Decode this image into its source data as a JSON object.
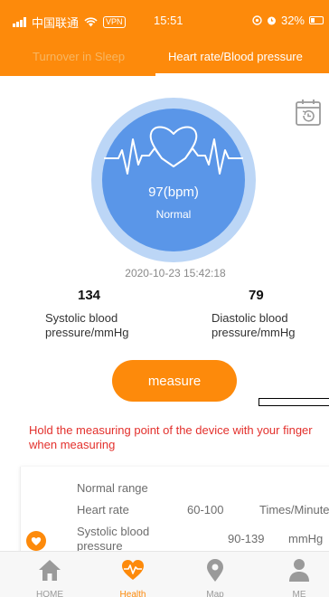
{
  "status_bar": {
    "carrier": "中国联通",
    "vpn": "VPN",
    "time": "15:51",
    "battery": "32%",
    "battery_level": 0.32
  },
  "tabs": [
    {
      "label": "Turnover in Sleep",
      "active": false
    },
    {
      "label": "Heart rate/Blood pressure",
      "active": true
    }
  ],
  "reading": {
    "bpm": "97(bpm)",
    "status": "Normal",
    "datetime": "2020-10-23 15:42:18",
    "systolic_value": "134",
    "systolic_label": "Systolic blood pressure/mmHg",
    "diastolic_value": "79",
    "diastolic_label": "Diastolic blood pressure/mmHg"
  },
  "measure_button": "measure",
  "hint": "Hold the measuring point of the device with your finger when measuring",
  "normal_range": {
    "title": "Normal range",
    "heart_rate_label": "Heart rate",
    "heart_rate_value": "60-100",
    "heart_rate_unit": "Times/Minute",
    "systolic_label": "Systolic blood pressure",
    "systolic_value": "90-139",
    "systolic_unit": "mmHg"
  },
  "bottom_nav": [
    {
      "label": "HOME",
      "icon": "home-icon",
      "active": false
    },
    {
      "label": "Health",
      "icon": "heartbeat-icon",
      "active": true
    },
    {
      "label": "Map",
      "icon": "map-pin-icon",
      "active": false
    },
    {
      "label": "ME",
      "icon": "person-icon",
      "active": false
    }
  ],
  "colors": {
    "accent": "#fd8a0b",
    "ring_outer": "#bcd6f6",
    "ring_inner": "#5a96e8",
    "hint": "#e3302c"
  }
}
